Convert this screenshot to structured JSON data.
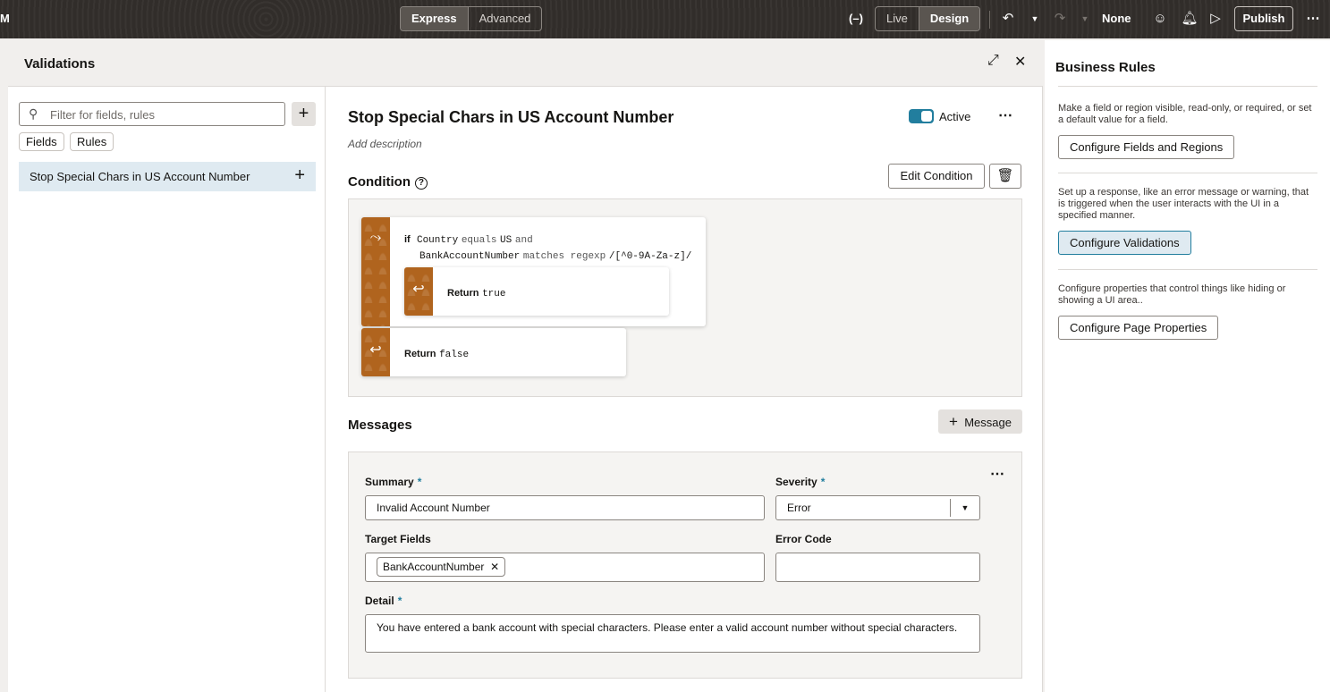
{
  "topbar": {
    "brand": "M",
    "mode_tabs": [
      "Express",
      "Advanced"
    ],
    "view_tabs": [
      "Live",
      "Design"
    ],
    "variable_label": "(–)",
    "none_label": "None",
    "publish": "Publish"
  },
  "panel": {
    "title": "Validations",
    "filter_placeholder": "Filter for fields, rules",
    "chips": [
      "Fields",
      "Rules"
    ],
    "rule_item": "Stop Special Chars in US Account Number"
  },
  "rule": {
    "title": "Stop Special Chars in US Account Number",
    "active_label": "Active",
    "description": "Add description",
    "condition_label": "Condition",
    "edit_condition": "Edit Condition",
    "if_kw": "if",
    "field1": "Country",
    "op1": "equals",
    "val1": "US",
    "and": "and",
    "field2": "BankAccountNumber",
    "op2": "matches regexp",
    "val2": "/[^0-9A-Za-z]/",
    "return_kw": "Return",
    "return_true": "true",
    "return_false": "false"
  },
  "messages": {
    "label": "Messages",
    "add_button": "Message",
    "summary_label": "Summary",
    "summary_value": "Invalid Account Number",
    "severity_label": "Severity",
    "severity_value": "Error",
    "target_label": "Target Fields",
    "target_tag": "BankAccountNumber",
    "error_code_label": "Error Code",
    "detail_label": "Detail",
    "detail_value": "You have entered a bank account with special characters. Please enter a valid account number without special characters.",
    "required_mark": "*"
  },
  "business_rules": {
    "title": "Business Rules",
    "sections": [
      {
        "text": "Make a field or region visible, read-only, or required, or set a default value for a field.",
        "button": "Configure Fields and Regions"
      },
      {
        "text": "Set up a response, like an error message or warning, that is triggered when the user interacts with the UI in a specified manner.",
        "button": "Configure Validations"
      },
      {
        "text": "Configure properties that control things like hiding or showing a UI area..",
        "button": "Configure Page Properties"
      }
    ]
  },
  "colors": {
    "accent": "#227e9e",
    "block": "#b0641e",
    "topbar": "#312d2a"
  }
}
